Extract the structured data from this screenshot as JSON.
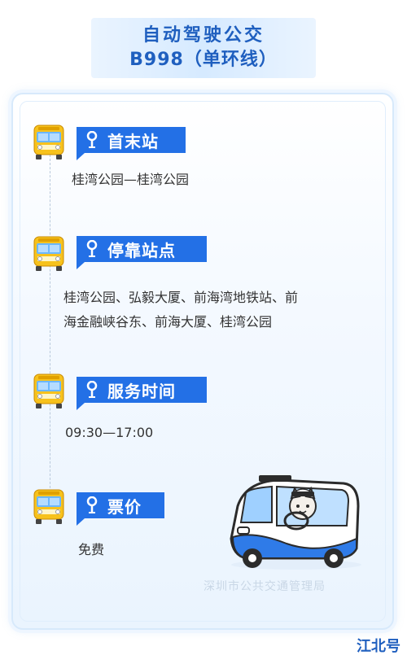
{
  "header": {
    "title_line1": "自动驾驶公交",
    "title_line2": "B998（单环线）"
  },
  "sections": [
    {
      "heading": "首末站",
      "content": "桂湾公园—桂湾公园"
    },
    {
      "heading": "停靠站点",
      "content_line1": "桂湾公园、弘毅大厦、前海湾地铁站、前",
      "content_line2": "海金融峡谷东、前海大厦、桂湾公园"
    },
    {
      "heading": "服务时间",
      "content": "09:30—17:00"
    },
    {
      "heading": "票价",
      "content": "免费"
    }
  ],
  "watermark": "深圳市公共交通管理局",
  "logo": "江北号",
  "colors": {
    "accent": "#2370e6",
    "title": "#1f5fbf",
    "bus_yellow": "#f7c21c"
  },
  "icons": {
    "bus": "bus-front-icon",
    "pin": "map-pin-icon"
  }
}
